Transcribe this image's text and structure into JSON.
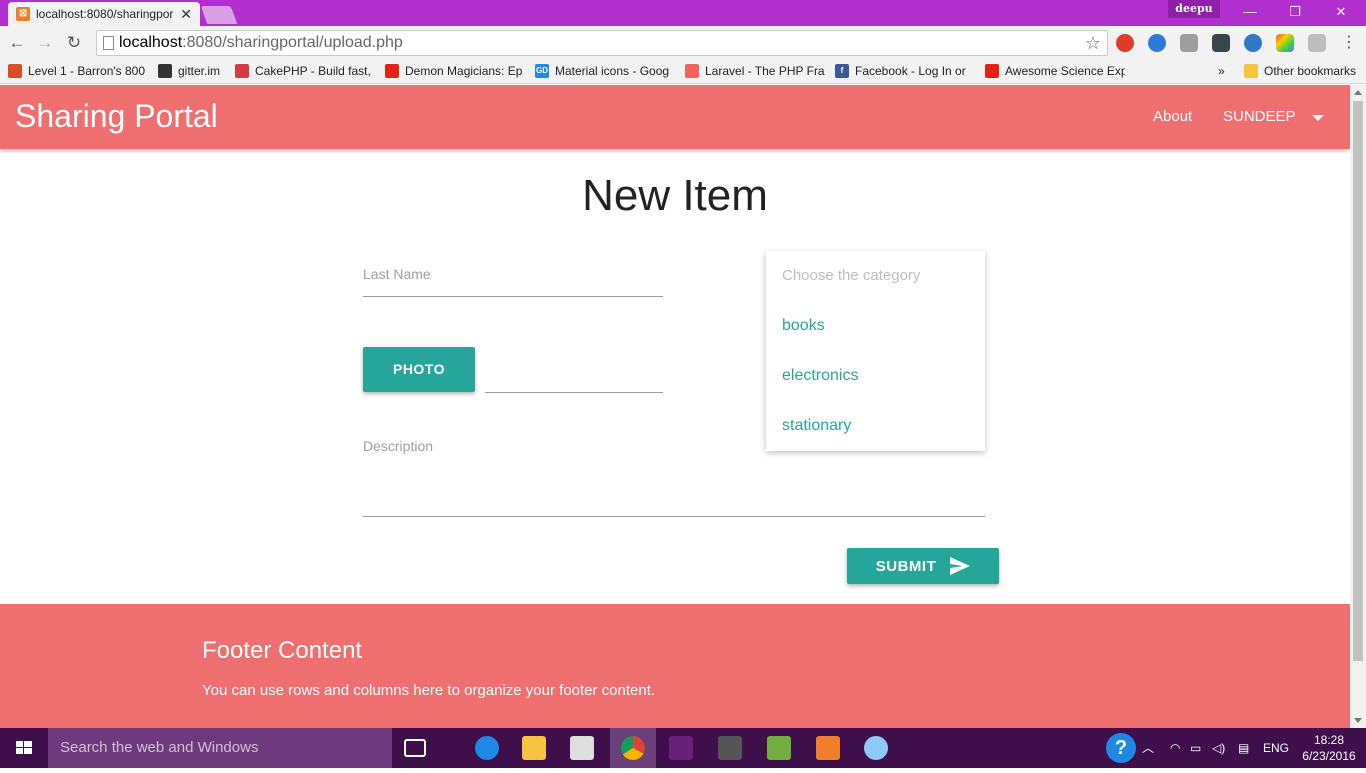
{
  "browser": {
    "tab_title": "localhost:8080/sharingpor",
    "tab_close": "✕",
    "profile_name": "deepu",
    "url_host": "localhost",
    "url_path": ":8080/sharingportal/upload.php",
    "window_controls": [
      "—",
      "❐",
      "✕"
    ],
    "bookmarks": [
      {
        "label": "Level 1 - Barron's 800",
        "color": "#d64f2a"
      },
      {
        "label": "gitter.im",
        "color": "#333333"
      },
      {
        "label": "CakePHP - Build fast,",
        "color": "#d33c43"
      },
      {
        "label": "Demon Magicians: Ep",
        "color": "#e62117"
      },
      {
        "label": "Material icons - Goog",
        "color": "#1e88e5"
      },
      {
        "label": "Laravel - The PHP Fra",
        "color": "#f4645f"
      },
      {
        "label": "Facebook - Log In or",
        "color": "#3b5998"
      },
      {
        "label": "Awesome Science Exp",
        "color": "#e62117"
      }
    ],
    "bookmarks_overflow": "»",
    "other_bookmarks": "Other bookmarks"
  },
  "navbar": {
    "brand": "Sharing Portal",
    "about": "About",
    "user": "SUNDEEP"
  },
  "form": {
    "title": "New Item",
    "last_name_label": "Last Name",
    "photo_button": "PHOTO",
    "description_label": "Description",
    "submit_button": "SUBMIT",
    "category_placeholder": "Choose the category",
    "categories": [
      "books",
      "electronics",
      "stationary"
    ]
  },
  "footer": {
    "title": "Footer Content",
    "text": "You can use rows and columns here to organize your footer content."
  },
  "taskbar": {
    "search_placeholder": "Search the web and Windows",
    "language": "ENG",
    "time": "18:28",
    "date": "6/23/2016"
  },
  "colors": {
    "primary": "#ef6f70",
    "accent": "#26a69a"
  }
}
